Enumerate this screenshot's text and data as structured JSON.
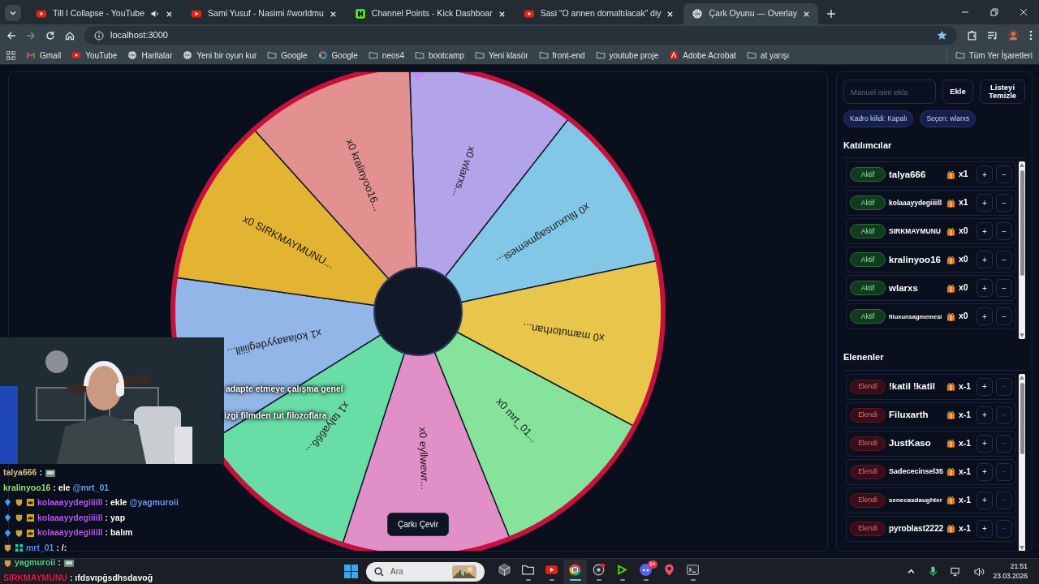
{
  "browser": {
    "tabs": [
      {
        "title": "Till I Collapse - YouTube",
        "kind": "play",
        "audio": true,
        "selected": false
      },
      {
        "title": "Sami Yusuf - Nasimi #worldmu",
        "kind": "play",
        "audio": false,
        "selected": false
      },
      {
        "title": "Channel Points - Kick Dashboar",
        "kind": "logo",
        "audio": false,
        "selected": false
      },
      {
        "title": "Sasi “O annen domaltılacak” diy",
        "kind": "play",
        "audio": false,
        "selected": false
      },
      {
        "title": "Çark Oyunu — Overlay",
        "kind": "globe",
        "audio": false,
        "selected": true
      }
    ],
    "address": "localhost:3000",
    "bookmarks": [
      {
        "label": "Gmail",
        "kind": "envelope"
      },
      {
        "label": "YouTube",
        "kind": "play"
      },
      {
        "label": "Haritalar",
        "kind": "globe"
      },
      {
        "label": "Yeni bir oyun kur",
        "kind": "globe"
      },
      {
        "label": "Google",
        "kind": "folder"
      },
      {
        "label": "Google",
        "kind": "ring"
      },
      {
        "label": "neos4",
        "kind": "folder"
      },
      {
        "label": "bootcamp",
        "kind": "folder"
      },
      {
        "label": "Yeni klasör",
        "kind": "folder"
      },
      {
        "label": "front-end",
        "kind": "folder"
      },
      {
        "label": "youtube proje",
        "kind": "folder"
      },
      {
        "label": "Adobe Acrobat",
        "kind": "document"
      },
      {
        "label": "at yarışı",
        "kind": "folder"
      }
    ],
    "all_bookmarks": "Tüm Yer İşaretleri"
  },
  "wheel": {
    "segments": [
      {
        "label": "x0 wlarxs...",
        "color": "#b3a3e8"
      },
      {
        "label": "x0 filuxunsagmemesi...",
        "color": "#82c8e6"
      },
      {
        "label": "x0 mamutorhan...",
        "color": "#e8c64c"
      },
      {
        "label": "x0 mrt_01...",
        "color": "#86e39c"
      },
      {
        "label": "x0 eyllwewr...",
        "color": "#e090c6"
      },
      {
        "label": "x1 talya666...",
        "color": "#68dea6"
      },
      {
        "label": "x1 kolaaayydegiiiill...",
        "color": "#92b6e8"
      },
      {
        "label": "x0 SIRKMAYMUNU...",
        "color": "#e2b432"
      },
      {
        "label": "x0 kralinyoo16...",
        "color": "#e29090"
      }
    ],
    "spin_button": "Çarkı Çevir"
  },
  "panel": {
    "name_input": {
      "placeholder": "Manuel isim ekle"
    },
    "add_button": "Ekle",
    "clear_button": "Listeyi Temizle",
    "chips": [
      "Kadro kilidi: Kapalı",
      "Seçen: wlarxs"
    ],
    "participants": {
      "title": "Katılımcılar",
      "rows": [
        {
          "status": "Aktif",
          "eliminated": false,
          "name": "talya666",
          "count": "x1",
          "plus": "+",
          "minus": "−"
        },
        {
          "status": "Aktif",
          "eliminated": false,
          "name": "kolaaayydegiiiill",
          "count": "x1",
          "plus": "+",
          "minus": "−"
        },
        {
          "status": "Aktif",
          "eliminated": false,
          "name": "SIRKMAYMUNU",
          "count": "x0",
          "plus": "+",
          "minus": "−"
        },
        {
          "status": "Aktif",
          "eliminated": false,
          "name": "kralinyoo16",
          "count": "x0",
          "plus": "+",
          "minus": "−"
        },
        {
          "status": "Aktif",
          "eliminated": false,
          "name": "wlarxs",
          "count": "x0",
          "plus": "+",
          "minus": "−"
        },
        {
          "status": "Aktif",
          "eliminated": false,
          "name": "filuxunsagmemesi",
          "count": "x0",
          "plus": "+",
          "minus": "−"
        }
      ]
    },
    "eliminated_list": {
      "title": "Elenenler",
      "rows": [
        {
          "status": "Elendi",
          "eliminated": true,
          "name": "!katil !katil",
          "count": "x-1",
          "plus": "+",
          "minus": "−"
        },
        {
          "status": "Elendi",
          "eliminated": true,
          "name": "Filuxarth",
          "count": "x-1",
          "plus": "+",
          "minus": "−"
        },
        {
          "status": "Elendi",
          "eliminated": true,
          "name": "JustKaso",
          "count": "x-1",
          "plus": "+",
          "minus": "−"
        },
        {
          "status": "Elendi",
          "eliminated": true,
          "name": "Sadececinsel35",
          "count": "x-1",
          "plus": "+",
          "minus": "−"
        },
        {
          "status": "Elendi",
          "eliminated": true,
          "name": "senecasdaughter",
          "count": "x-1",
          "plus": "+",
          "minus": "−"
        },
        {
          "status": "Elendi",
          "eliminated": true,
          "name": "pyroblast2222",
          "count": "x-1",
          "plus": "+",
          "minus": "−"
        }
      ]
    }
  },
  "overlay": {
    "webcam": {
      "kind": "picture"
    },
    "captions": [
      "adapte etmeye çalışma genel",
      "izgi filmden tut filozoflara"
    ],
    "chat": [
      {
        "user": "talya666",
        "color": "#d8c48a",
        "text": ":",
        "emote": true
      },
      {
        "user": "kralinyoo16",
        "color": "#9be07a",
        "text": ": ele",
        "mention": "@mrt_01"
      },
      {
        "user": "kolaaayydegiiiill",
        "color": "#b45cf0",
        "badges": [
          {
            "kind": "gem"
          },
          {
            "kind": "shield"
          },
          {
            "kind": "crown"
          }
        ],
        "text": ": ekle",
        "mention": "@yagmuroii"
      },
      {
        "user": "kolaaayydegiiiill",
        "color": "#b45cf0",
        "badges": [
          {
            "kind": "gem"
          },
          {
            "kind": "shield"
          },
          {
            "kind": "crown"
          }
        ],
        "text": ": yap"
      },
      {
        "user": "kolaaayydegiiiill",
        "color": "#b45cf0",
        "badges": [
          {
            "kind": "gem"
          },
          {
            "kind": "shield"
          },
          {
            "kind": "crown"
          }
        ],
        "text": ": balım"
      },
      {
        "user": "mrt_01",
        "color": "#5a8cf0",
        "badges": [
          {
            "kind": "shield"
          },
          {
            "kind": "grid"
          }
        ],
        "text": ": /:"
      },
      {
        "user": "yagmuroii",
        "color": "#4fd48a",
        "badges": [
          {
            "kind": "shield"
          }
        ],
        "text": ":",
        "emote": true
      },
      {
        "user": "SIRKMAYMUNU",
        "color": "#e0204a",
        "text": ": ıfdsvıpğsdhsdavoğ"
      }
    ]
  },
  "taskbar": {
    "search": {
      "placeholder": "Ara"
    },
    "apps": [
      {
        "kind": "cube",
        "selected": false,
        "running": false
      },
      {
        "kind": "folder",
        "selected": false,
        "running": true
      },
      {
        "kind": "play",
        "selected": false,
        "running": true
      },
      {
        "kind": "browser",
        "selected": true,
        "running": true
      },
      {
        "kind": "record",
        "selected": false,
        "running": true
      },
      {
        "kind": "triangle",
        "selected": false,
        "running": true
      },
      {
        "kind": "chat",
        "selected": false,
        "running": true,
        "badge": "9+"
      },
      {
        "kind": "pin",
        "selected": false,
        "running": false
      },
      {
        "kind": "terminal",
        "selected": false,
        "running": true
      }
    ],
    "time": "21:51",
    "date": "23.03.2026"
  }
}
